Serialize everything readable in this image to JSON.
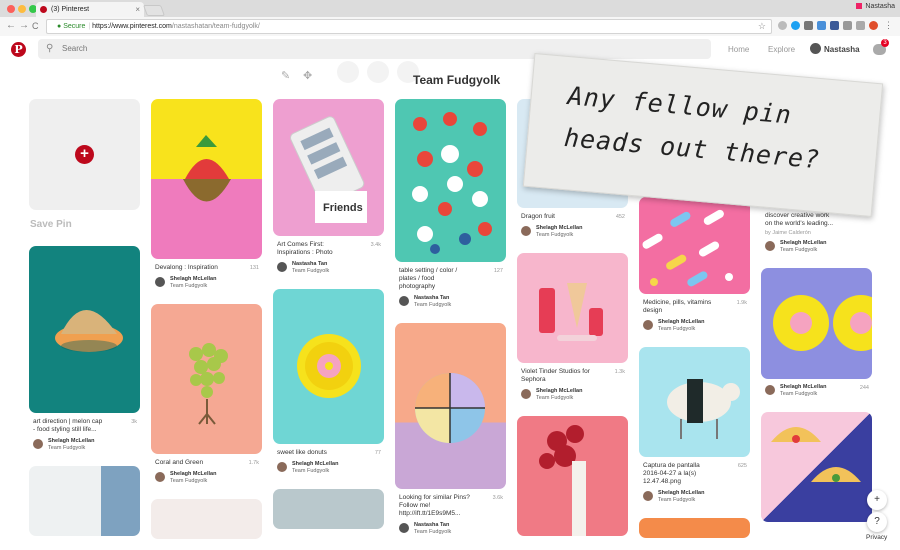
{
  "browser": {
    "tab_title": "(3) Pinterest",
    "tab_close": "×",
    "profile_name": "Nastasha",
    "nav_back": "←",
    "nav_forward": "→",
    "nav_reload": "C",
    "secure_label": "Secure",
    "url_host": "https://www.pinterest.com",
    "url_path": "/nastashatan/team-fudgyolk/",
    "bookmark_star": "☆"
  },
  "header": {
    "logo": "P",
    "search_placeholder": "Search",
    "home_label": "Home",
    "explore_label": "Explore",
    "user_name": "Nastasha",
    "notification_count": "3"
  },
  "board": {
    "title": "Team Fudgyolk",
    "save_pin_label": "Save Pin"
  },
  "note": {
    "line1": "Any fellow pin",
    "line2": "heads  out there?"
  },
  "pins": {
    "c1": [
      {
        "desc": "art direction | melon cap - food styling still life...",
        "count": "3k",
        "name": "Shelagh McLellan",
        "board": "Team Fudgyolk"
      }
    ],
    "c2": [
      {
        "desc": "Devalong : Inspiration",
        "count": "131",
        "name": "Shelagh McLellan",
        "board": "Team Fudgyolk"
      },
      {
        "desc": "Coral and Green",
        "count": "1.7k",
        "name": "Shelagh McLellan",
        "board": "Team Fudgyolk"
      }
    ],
    "c3": [
      {
        "desc": "Art Comes First: Inspirations : Photo",
        "count": "3.4k",
        "name": "Nastasha Tan",
        "board": "Team Fudgyolk"
      },
      {
        "desc": "sweet like donuts",
        "count": "77",
        "name": "Shelagh McLellan",
        "board": "Team Fudgyolk"
      }
    ],
    "c4": [
      {
        "desc": "table setting / color / plates / food photography",
        "count": "127",
        "name": "Nastasha Tan",
        "board": "Team Fudgyolk"
      },
      {
        "desc": "Looking for similar Pins? Follow me! http://ift.tt/1E9s9M5...",
        "count": "3.6k",
        "name": "Nastasha Tan",
        "board": "Team Fudgyolk"
      }
    ],
    "c5": [
      {
        "desc": "Dragon fruit",
        "count": "452",
        "name": "Shelagh McLellan",
        "board": "Team Fudgyolk"
      },
      {
        "desc": "Violet Tinder Studios for Sephora",
        "count": "1.3k",
        "name": "Shelagh McLellan",
        "board": "Team Fudgyolk"
      }
    ],
    "c6": [
      {
        "desc": "Medicine, pills, vitamins design",
        "count": "1.9k",
        "name": "Shelagh McLellan",
        "board": "Team Fudgyolk"
      },
      {
        "desc": "Captura de pantalla 2016-04-27 a la(s) 12.47.48.png",
        "count": "625",
        "name": "Shelagh McLellan",
        "board": "Team Fudgyolk"
      }
    ],
    "c7": [
      {
        "desc": "discover creative work on the world's leading...",
        "sub": "by Jaime Calderón",
        "count": "",
        "name": "Shelagh McLellan",
        "board": "Team Fudgyolk"
      },
      {
        "desc": "",
        "count": "244",
        "name": "Shelagh McLellan",
        "board": "Team Fudgyolk"
      }
    ]
  },
  "side": {
    "add": "+",
    "help": "?",
    "privacy": "Privacy"
  }
}
